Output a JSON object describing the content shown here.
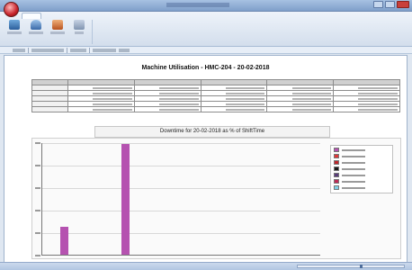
{
  "report": {
    "title": "Machine Utilisation - HMC-204 - 20-02-2018",
    "chart_heading": "Downtime for 20-02-2018 as % of ShiftTime"
  },
  "chart_data": {
    "type": "bar",
    "title": "Downtime for 20-02-2018 as % of ShiftTime",
    "value_scale": "fraction of plot height (axis tick values not legible)",
    "series": [
      {
        "values": [
          0.25,
          1.0
        ],
        "color": "#b552b0"
      }
    ],
    "legend_placement": "top-right",
    "legend_colors": [
      "#b552b0",
      "#e03838",
      "#c0262c",
      "#1a1a1a",
      "#5a3d7a",
      "#bf2a56",
      "#7fd0e8"
    ],
    "grid": true
  },
  "table": {
    "data_rows": 5,
    "data_columns": 5
  },
  "colors": {
    "accent_bar": "#b552b0",
    "app_orb": "#c7222a",
    "chrome": "#dfe7f1"
  },
  "view": {
    "zoom_fraction": 0.6
  }
}
